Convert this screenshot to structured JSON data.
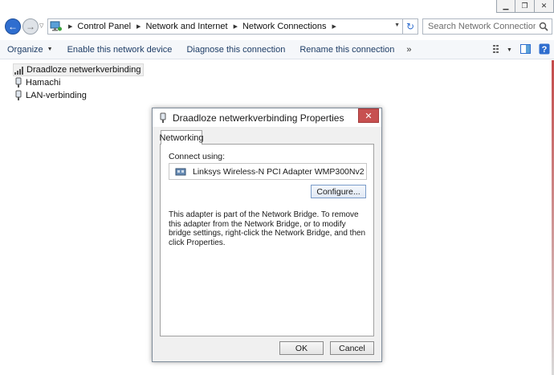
{
  "window": {
    "controls": {
      "minimize": "▁",
      "restore": "❐",
      "close": "✕"
    }
  },
  "address": {
    "crumbs": [
      "Control Panel",
      "Network and Internet",
      "Network Connections"
    ],
    "search_placeholder": "Search Network Connections"
  },
  "toolbar": {
    "organize": "Organize",
    "enable_device": "Enable this network device",
    "diagnose": "Diagnose this connection",
    "rename": "Rename this connection",
    "more": "»"
  },
  "connections": [
    {
      "name": "Draadloze netwerkverbinding",
      "icon": "wireless-signal-icon",
      "selected": true
    },
    {
      "name": "Hamachi",
      "icon": "network-adapter-icon",
      "selected": false
    },
    {
      "name": "LAN-verbinding",
      "icon": "network-adapter-icon",
      "selected": false
    }
  ],
  "dialog": {
    "title": "Draadloze netwerkverbinding Properties",
    "tab": "Networking",
    "connect_using_label": "Connect using:",
    "adapter": "Linksys Wireless-N PCI Adapter WMP300Nv2",
    "configure": "Configure...",
    "description": "This adapter is part of the Network Bridge.  To remove this adapter from the Network Bridge, or to modify bridge settings, right-click the Network Bridge, and then click Properties.",
    "ok": "OK",
    "cancel": "Cancel"
  },
  "colors": {
    "accent": "#2f6ecf",
    "close_red": "#c75050",
    "cmdbar_bg": "#f5f7fa"
  }
}
